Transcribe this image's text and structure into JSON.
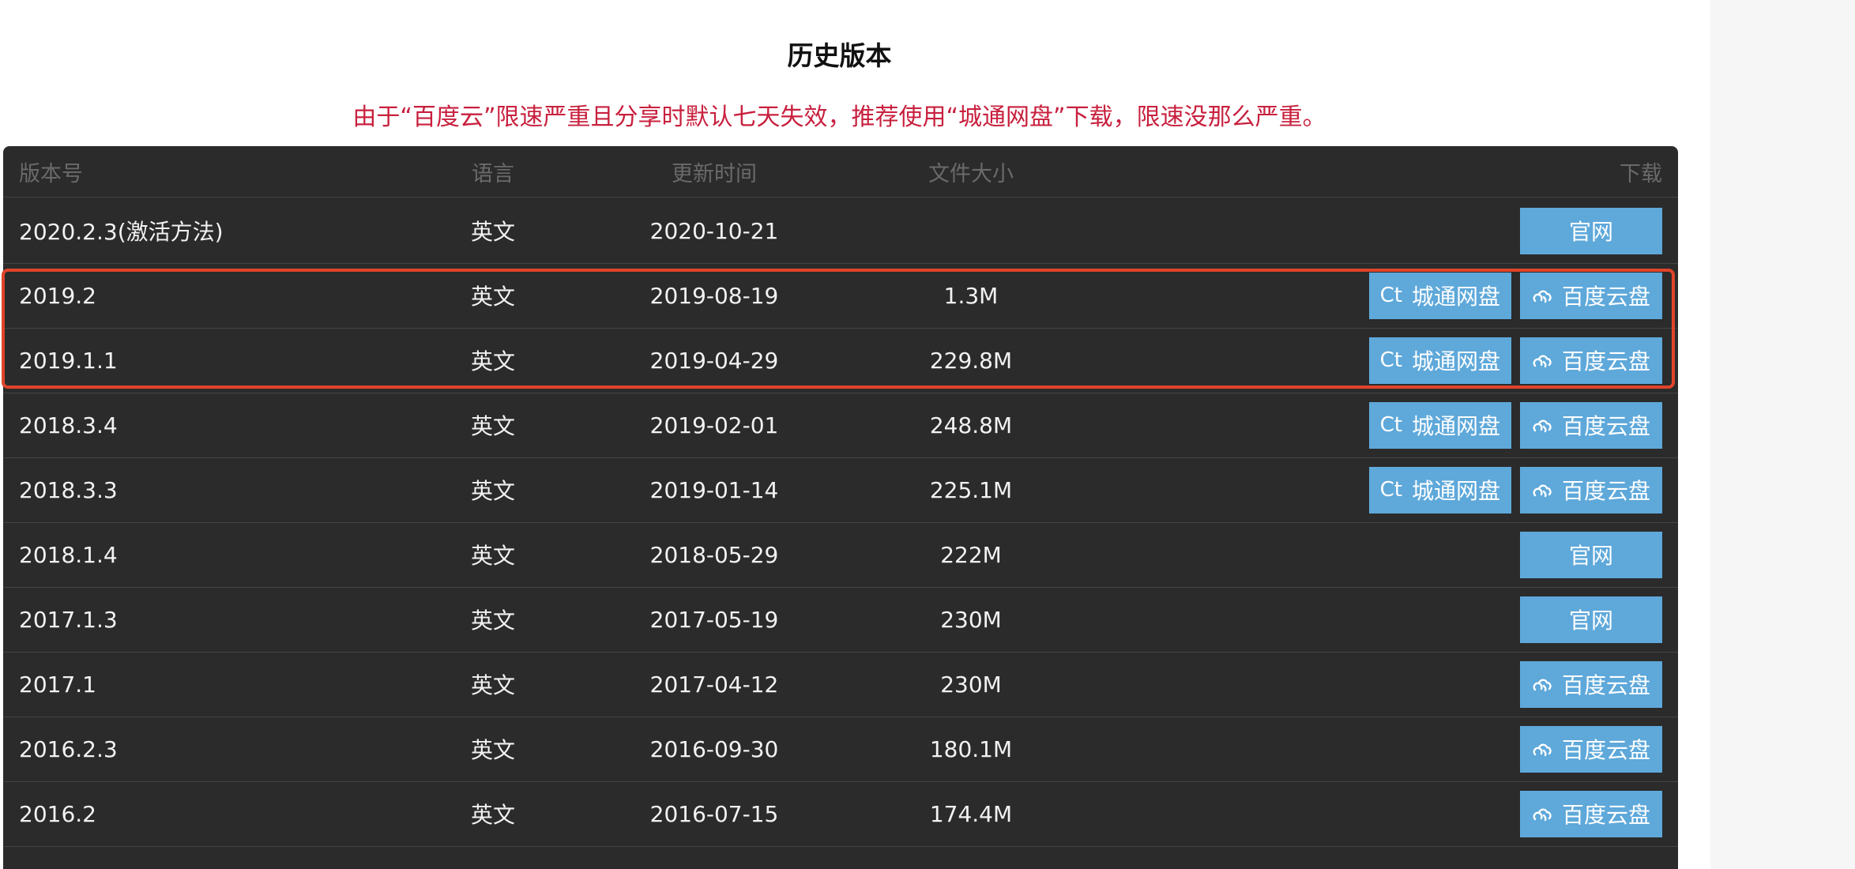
{
  "page": {
    "title": "历史版本",
    "notice": "由于“百度云”限速严重且分享时默认七天失效，推荐使用“城通网盘”下载，限速没那么严重。"
  },
  "table": {
    "headers": {
      "version": "版本号",
      "language": "语言",
      "updated": "更新时间",
      "size": "文件大小",
      "download": "下载"
    },
    "button_labels": {
      "official": "官网",
      "ctfile": "城通网盘",
      "baidu": "百度云盘",
      "ctfile_icon_text": "Ct"
    },
    "rows": [
      {
        "version": "2020.2.3(激活方法)",
        "language": "英文",
        "date": "2020-10-21",
        "size": "",
        "downloads": [
          "official"
        ]
      },
      {
        "version": "2019.2",
        "language": "英文",
        "date": "2019-08-19",
        "size": "1.3M",
        "downloads": [
          "ctfile",
          "baidu"
        ]
      },
      {
        "version": "2019.1.1",
        "language": "英文",
        "date": "2019-04-29",
        "size": "229.8M",
        "downloads": [
          "ctfile",
          "baidu"
        ]
      },
      {
        "version": "2018.3.4",
        "language": "英文",
        "date": "2019-02-01",
        "size": "248.8M",
        "downloads": [
          "ctfile",
          "baidu"
        ]
      },
      {
        "version": "2018.3.3",
        "language": "英文",
        "date": "2019-01-14",
        "size": "225.1M",
        "downloads": [
          "ctfile",
          "baidu"
        ]
      },
      {
        "version": "2018.1.4",
        "language": "英文",
        "date": "2018-05-29",
        "size": "222M",
        "downloads": [
          "official"
        ]
      },
      {
        "version": "2017.1.3",
        "language": "英文",
        "date": "2017-05-19",
        "size": "230M",
        "downloads": [
          "official"
        ]
      },
      {
        "version": "2017.1",
        "language": "英文",
        "date": "2017-04-12",
        "size": "230M",
        "downloads": [
          "baidu"
        ]
      },
      {
        "version": "2016.2.3",
        "language": "英文",
        "date": "2016-09-30",
        "size": "180.1M",
        "downloads": [
          "baidu"
        ]
      },
      {
        "version": "2016.2",
        "language": "英文",
        "date": "2016-07-15",
        "size": "174.4M",
        "downloads": [
          "baidu"
        ]
      }
    ]
  },
  "colors": {
    "accent": "#5ea8da",
    "notice": "#c8203e",
    "highlight": "#e0442a",
    "table_bg": "#2b2b2b"
  },
  "icons": {
    "ctfile": "ctfile-logo-icon",
    "baidu": "baidu-cloud-icon"
  }
}
